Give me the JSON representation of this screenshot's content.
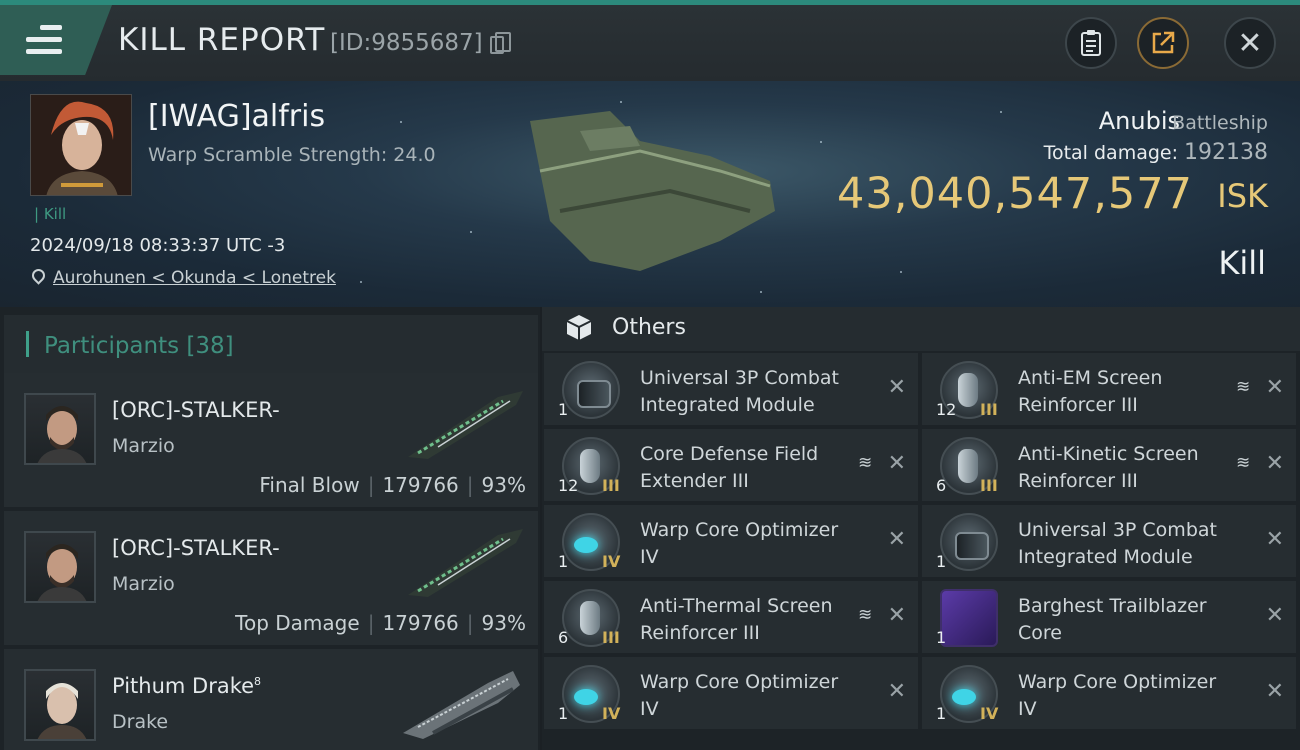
{
  "header": {
    "title": "KILL REPORT",
    "report_id": "[ID:9855687]",
    "menu_icon": "hamburger-menu-icon",
    "clipboard_icon": "clipboard-icon",
    "share_icon": "share-icon",
    "close_icon": "close-icon"
  },
  "victim": {
    "name": "[IWAG]alfris",
    "warp_scramble": "Warp Scramble Strength: 24.0",
    "tag": "Kill",
    "timestamp": "2024/09/18 08:33:37 UTC -3",
    "location": "Aurohunen < Okunda < Lonetrek",
    "ship_name": "Anubis",
    "ship_class": "Battleship",
    "total_damage_label": "Total damage:",
    "total_damage": "192138",
    "isk_value": "43,040,547,577",
    "isk_unit": "ISK",
    "outcome": "Kill"
  },
  "participants": {
    "title": "Participants",
    "count": "[38]",
    "rows": [
      {
        "name": "[ORC]-STALKER-",
        "ship": "Marzio",
        "role": "Final Blow",
        "damage": "179766",
        "percent": "93%"
      },
      {
        "name": "[ORC]-STALKER-",
        "ship": "Marzio",
        "role": "Top Damage",
        "damage": "179766",
        "percent": "93%"
      },
      {
        "name": "Pithum Drake",
        "sup": "8",
        "ship": "Drake",
        "role": "",
        "damage": "",
        "percent": ""
      }
    ]
  },
  "others": {
    "title": "Others",
    "items": [
      {
        "name": "Universal 3P Combat Integrated Module",
        "qty": "1",
        "tier": "",
        "icon": "core",
        "stack": false
      },
      {
        "name": "Anti-EM Screen Reinforcer III",
        "qty": "12",
        "tier": "III",
        "icon": "shield",
        "stack": true
      },
      {
        "name": "Core Defense Field Extender III",
        "qty": "12",
        "tier": "III",
        "icon": "shield",
        "stack": true
      },
      {
        "name": "Anti-Kinetic Screen Reinforcer III",
        "qty": "6",
        "tier": "III",
        "icon": "shield",
        "stack": true
      },
      {
        "name": "Warp Core Optimizer IV",
        "qty": "1",
        "tier": "IV",
        "icon": "blue",
        "stack": false
      },
      {
        "name": "Universal 3P Combat Integrated Module",
        "qty": "1",
        "tier": "",
        "icon": "core",
        "stack": false
      },
      {
        "name": "Anti-Thermal Screen Reinforcer III",
        "qty": "6",
        "tier": "III",
        "icon": "shield",
        "stack": true
      },
      {
        "name": "Barghest Trailblazer Core",
        "qty": "1",
        "tier": "",
        "icon": "square",
        "stack": false
      },
      {
        "name": "Warp Core Optimizer IV",
        "qty": "1",
        "tier": "IV",
        "icon": "blue",
        "stack": false
      },
      {
        "name": "Warp Core Optimizer IV",
        "qty": "1",
        "tier": "IV",
        "icon": "blue",
        "stack": false
      }
    ]
  },
  "colors": {
    "accent": "#3fa08a",
    "isk_gold": "#e6c878",
    "background": "#1d2327"
  }
}
